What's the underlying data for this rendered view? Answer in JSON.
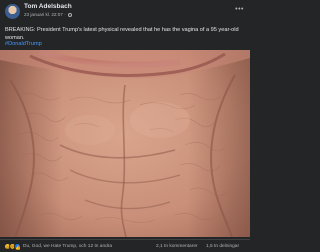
{
  "post": {
    "author": "Tom Adelsbach",
    "timestamp": "23 januari kl. 22:07",
    "visibility_icon": "globe-icon",
    "menu_icon": "more-icon",
    "text": "BREAKING: President Trump's latest physical revealed that he has the vagina of a 95 year-old woman.",
    "hashtag": "#DonaldTrump",
    "image": "close-up-photo"
  },
  "footer": {
    "reaction_icons": [
      "haha-icon",
      "sad-icon",
      "like-icon"
    ],
    "reactions_text": "Du, God, we Hate Trump, och 12 tn andra",
    "comments_text": "2,1 tn kommentarer",
    "shares_text": "1,5 tn delningar"
  },
  "colors": {
    "background": "#242526",
    "text": "#e4e6eb",
    "secondary_text": "#b0b3b8",
    "link": "#4599ff",
    "like_blue": "#1877f2",
    "emoji_yellow": "#f7b928"
  }
}
